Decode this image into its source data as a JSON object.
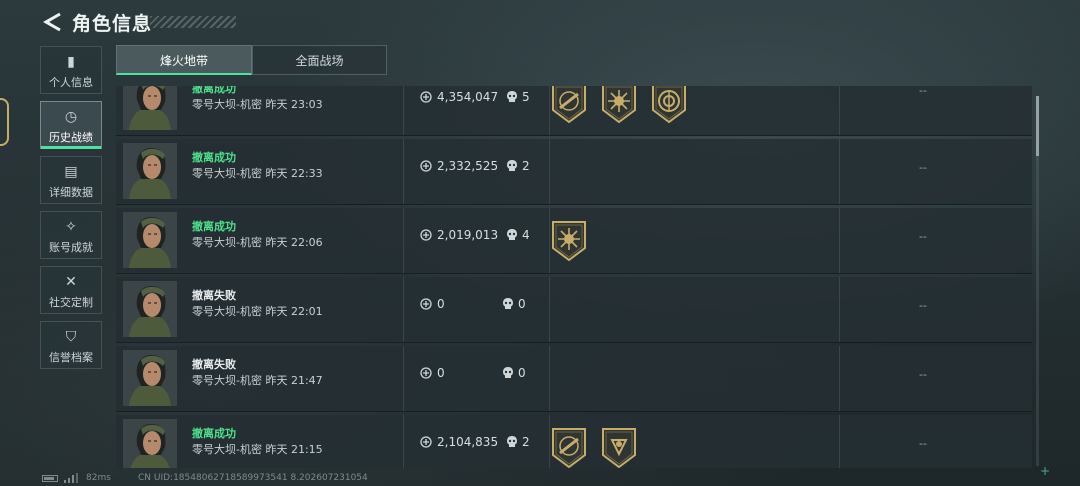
{
  "header": {
    "title": "角色信息",
    "back_icon": "back-arrow-icon"
  },
  "sidebar": {
    "items": [
      {
        "label": "个人信息",
        "icon": "bar-chart-icon",
        "glyph": "▮",
        "active": false
      },
      {
        "label": "历史战绩",
        "icon": "history-icon",
        "glyph": "◷",
        "active": true
      },
      {
        "label": "详细数据",
        "icon": "folder-icon",
        "glyph": "▤",
        "active": false
      },
      {
        "label": "账号成就",
        "icon": "achievement-icon",
        "glyph": "✧",
        "active": false
      },
      {
        "label": "社交定制",
        "icon": "tools-icon",
        "glyph": "✕",
        "active": false
      },
      {
        "label": "信誉档案",
        "icon": "shield-icon",
        "glyph": "⛉",
        "active": false
      }
    ]
  },
  "tabs": [
    {
      "label": "烽火地带",
      "active": true
    },
    {
      "label": "全面战场",
      "active": false
    }
  ],
  "records": [
    {
      "status": "撤离成功",
      "success": true,
      "map": "零号大坝-机密",
      "time": "昨天 23:03",
      "value": "4,354,047",
      "kills": "5",
      "badges": [
        "rifle-badge-icon",
        "sun-badge-icon",
        "compass-badge-icon"
      ],
      "extra": "--"
    },
    {
      "status": "撤离成功",
      "success": true,
      "map": "零号大坝-机密",
      "time": "昨天 22:33",
      "value": "2,332,525",
      "kills": "2",
      "badges": [],
      "extra": "--"
    },
    {
      "status": "撤离成功",
      "success": true,
      "map": "零号大坝-机密",
      "time": "昨天 22:06",
      "value": "2,019,013",
      "kills": "4",
      "badges": [
        "sun-badge-icon"
      ],
      "extra": "--"
    },
    {
      "status": "撤离失败",
      "success": false,
      "map": "零号大坝-机密",
      "time": "昨天 22:01",
      "value": "0",
      "kills": "0",
      "badges": [],
      "extra": "--"
    },
    {
      "status": "撤离失败",
      "success": false,
      "map": "零号大坝-机密",
      "time": "昨天 21:47",
      "value": "0",
      "kills": "0",
      "badges": [],
      "extra": "--"
    },
    {
      "status": "撤离成功",
      "success": true,
      "map": "零号大坝-机密",
      "time": "昨天 21:15",
      "value": "2,104,835",
      "kills": "2",
      "badges": [
        "rifle-badge-icon",
        "crest-badge-icon"
      ],
      "extra": "--"
    }
  ],
  "footer": {
    "ping": "82ms",
    "uid": "CN UID:18548062718589973541 8.202607231054"
  },
  "colors": {
    "success": "#4ee08d",
    "accent": "#4fe0a0",
    "badge_gold": "#c7ad6a"
  }
}
